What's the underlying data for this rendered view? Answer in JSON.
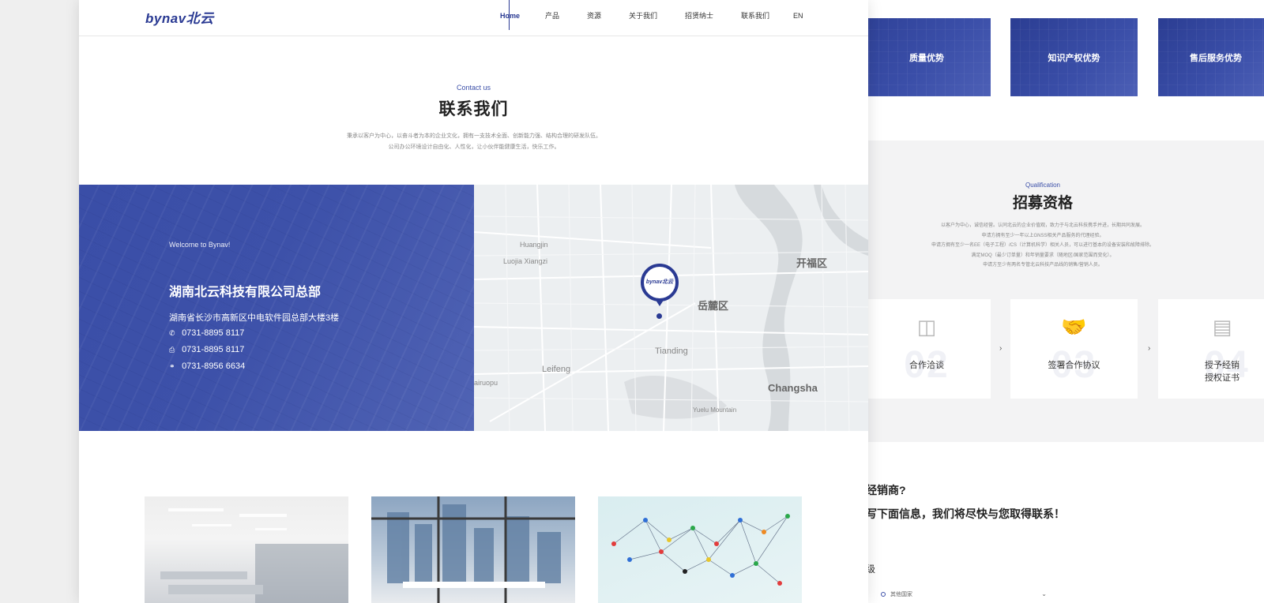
{
  "header": {
    "logo": "bynav北云",
    "nav": [
      "Home",
      "产品",
      "资源",
      "关于我们",
      "招贤纳士",
      "联系我们",
      "EN"
    ],
    "active": "Home"
  },
  "contact_section": {
    "en_title": "Contact us",
    "cn_title": "联系我们",
    "desc_line1": "秉承以客户为中心，以奋斗者为本的企业文化，拥有一支技术全面、创新能力强、结构合理的研发队伍。",
    "desc_line2": "公司办公环境设计自由化、人性化，让小伙伴能健康生活，快乐工作。"
  },
  "contact_card": {
    "welcome": "Welcome to Bynav!",
    "company": "湖南北云科技有限公司总部",
    "address": "湖南省长沙市高新区中电软件园总部大楼3楼",
    "phone": "0731-8895 8117",
    "fax": "0731-8895 8117",
    "service": "0731-8956 6634",
    "icons": {
      "phone": "phone-icon",
      "fax": "fax-icon",
      "service": "headset-icon"
    }
  },
  "map": {
    "labels": [
      "Huangjin",
      "Luojia Xiangzi",
      "开福区",
      "岳麓区",
      "Tianding",
      "Leifeng",
      "Changsha",
      "Yuelu Mountain",
      "airuopu"
    ],
    "pin_text": "bynav北云"
  },
  "right_page": {
    "advantages": [
      "质量优势",
      "知识产权优势",
      "售后服务优势"
    ],
    "qualification": {
      "en": "Qualification",
      "cn": "招募资格",
      "lines": [
        "以客户为中心，诚信经营。认同北云的企业价值观，致力于与北云科技携手并进，长期共同发展。",
        "申请方拥有至少一年以上GNSS相关产品服务的代理经验。",
        "申请方拥有至少一名EE（电子工程）/CS（计算机科学）相关人员，可以进行基本的设备安装和故障排除。",
        "满足MOQ（最少订单量）和年销量要求（随地区/国家范围而变化）。",
        "申请方至少有两名专管北云科技产品线的销售/营销人员。"
      ]
    },
    "steps": [
      {
        "num": "02",
        "label": "合作洽谈",
        "icon": "meeting-icon"
      },
      {
        "num": "03",
        "label": "签署合作协议",
        "icon": "handshake-icon"
      },
      {
        "num": "04",
        "label": "授予经销\n授权证书",
        "icon": "certificate-icon"
      }
    ],
    "distributor_q": "经销商?",
    "distributor_text": "写下面信息，我们将尽快与您取得联系！",
    "form_label": "级",
    "country_placeholder": "其他国家"
  }
}
